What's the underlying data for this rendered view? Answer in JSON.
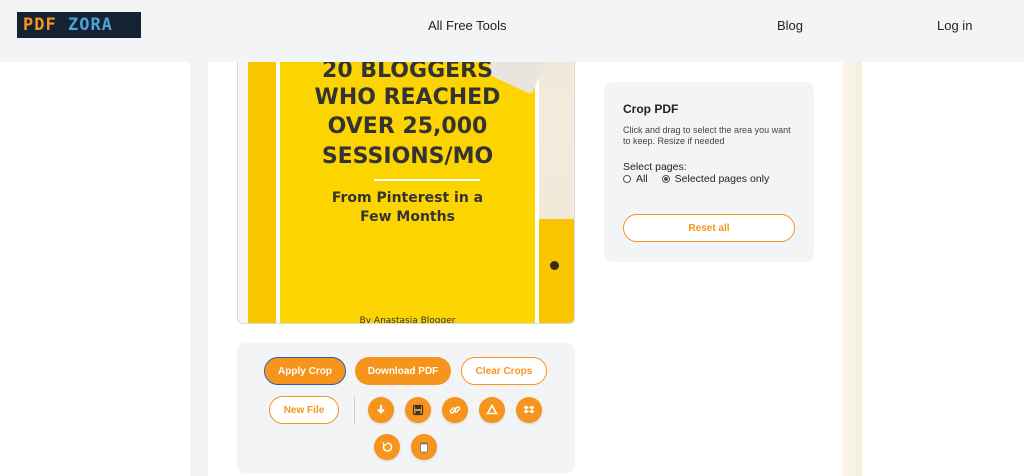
{
  "header": {
    "logo": {
      "part1": "PDF",
      "part2": "ZORA"
    },
    "nav": {
      "tools": "All Free Tools",
      "blog": "Blog",
      "login": "Log in"
    }
  },
  "preview": {
    "lines": [
      "20 BLOGGERS",
      "WHO REACHED",
      "OVER 25,000",
      "SESSIONS/MO"
    ],
    "subtitle": [
      "From Pinterest in a",
      "Few Months"
    ],
    "byline": "By Anastasia Blogger"
  },
  "crop_panel": {
    "title": "Crop PDF",
    "description": "Click and drag to select the area you want to keep. Resize if needed",
    "select_label": "Select pages:",
    "options": [
      {
        "label": "All",
        "checked": false
      },
      {
        "label": "Selected pages only",
        "checked": true
      }
    ],
    "reset_label": "Reset all"
  },
  "actions": {
    "apply": "Apply Crop",
    "download": "Download PDF",
    "clear": "Clear Crops",
    "new_file": "New File",
    "icons": [
      "download-icon",
      "save-icon",
      "link-icon",
      "google-drive-icon",
      "dropbox-icon",
      "undo-icon",
      "trash-icon"
    ]
  },
  "colors": {
    "accent": "#f7941d",
    "header_bg": "#f3f4f6",
    "logo_bg": "#142233",
    "cover_yellow": "#fcd400"
  }
}
